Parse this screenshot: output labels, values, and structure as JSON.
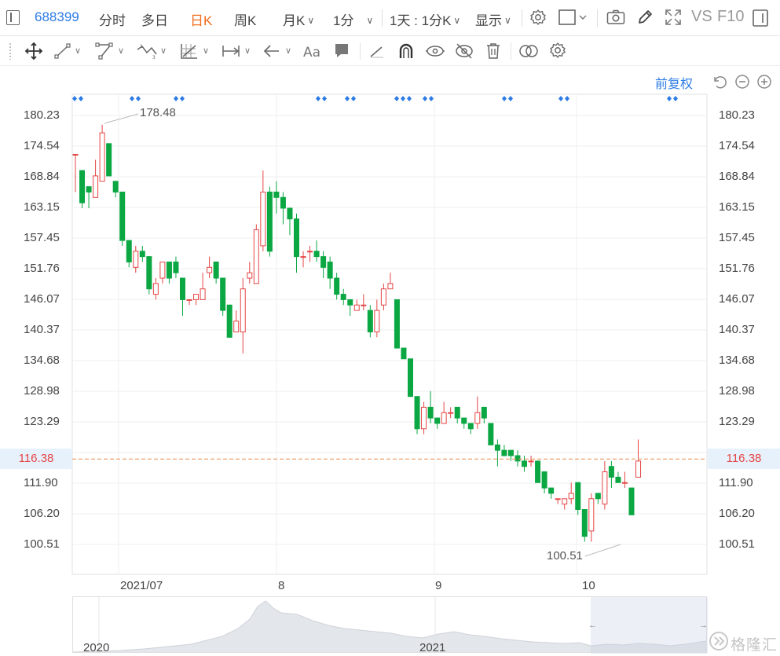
{
  "toolbar": {
    "stock_code": "688399",
    "intraday": "分时",
    "multi_day": "多日",
    "day_k": "日K",
    "week_k": "周K",
    "month_k": "月K",
    "minute_1": "1分",
    "interval": "1天 : 1分K",
    "display": "显示",
    "vs": "VS",
    "f10": "F10"
  },
  "chart_tools": {
    "restore_right": "前复权"
  },
  "price_axis": {
    "ticks": [
      "180.23",
      "174.54",
      "168.84",
      "163.15",
      "157.45",
      "151.76",
      "146.07",
      "140.37",
      "134.68",
      "128.98",
      "123.29",
      "111.90",
      "106.20",
      "100.51"
    ],
    "current_price": "116.38",
    "max_label": "178.48",
    "min_label": "100.51"
  },
  "time_axis": {
    "labels": [
      "2021/07",
      "8",
      "9",
      "10"
    ]
  },
  "navigator": {
    "labels": [
      "2020",
      "2021"
    ]
  },
  "watermark": {
    "text": "格隆汇"
  },
  "colors": {
    "up": "#e54545",
    "down": "#0aa743",
    "accent": "#2c7be5",
    "active_tab": "#f26a1b",
    "current_line": "#e98a4a"
  },
  "chart_data": {
    "type": "candlestick",
    "candles": [
      [
        173,
        173,
        166,
        173
      ],
      [
        170,
        164,
        163,
        170
      ],
      [
        167,
        166,
        163,
        167
      ],
      [
        165,
        169,
        165,
        172
      ],
      [
        168,
        177,
        168,
        178.5
      ],
      [
        175,
        169,
        169,
        175
      ],
      [
        168,
        166,
        165,
        168
      ],
      [
        166,
        157,
        156,
        166
      ],
      [
        157,
        153,
        152,
        157
      ],
      [
        152,
        155,
        151,
        156
      ],
      [
        155,
        154,
        153,
        156
      ],
      [
        154,
        148,
        147,
        154
      ],
      [
        147,
        149,
        146,
        150
      ],
      [
        150,
        153,
        149,
        153
      ],
      [
        153,
        150,
        149,
        153
      ],
      [
        153,
        151,
        150,
        154
      ],
      [
        150,
        146,
        143,
        150
      ],
      [
        146,
        146,
        145,
        146
      ],
      [
        146,
        147,
        145,
        147
      ],
      [
        146,
        148,
        147,
        151
      ],
      [
        151,
        152,
        150,
        154
      ],
      [
        153,
        150,
        149,
        153
      ],
      [
        150,
        144,
        143,
        150
      ],
      [
        145,
        139,
        139,
        145
      ],
      [
        140,
        142,
        140,
        144
      ],
      [
        140,
        148,
        136,
        150
      ],
      [
        150,
        151,
        149,
        153
      ],
      [
        149,
        159,
        149,
        160
      ],
      [
        156,
        166,
        155,
        170
      ],
      [
        166,
        155,
        154,
        167
      ],
      [
        166,
        165,
        162,
        168
      ],
      [
        165,
        163,
        160,
        166
      ],
      [
        163,
        161,
        158,
        163
      ],
      [
        161,
        154,
        151,
        162
      ],
      [
        154,
        154,
        152,
        155
      ],
      [
        155,
        155,
        153,
        156
      ],
      [
        155,
        154,
        153,
        157
      ],
      [
        154,
        152,
        150,
        155
      ],
      [
        153,
        150,
        148,
        154
      ],
      [
        150,
        147,
        146,
        151
      ],
      [
        147,
        146,
        145,
        148
      ],
      [
        146,
        145,
        143,
        146
      ],
      [
        144,
        145,
        144,
        146
      ],
      [
        145,
        145,
        144,
        147
      ],
      [
        144,
        140,
        139,
        145
      ],
      [
        140,
        144,
        139,
        146
      ],
      [
        145,
        148,
        144,
        149
      ],
      [
        148,
        149,
        148,
        151
      ],
      [
        146,
        137,
        137,
        146
      ],
      [
        137,
        135,
        135,
        137
      ],
      [
        135,
        128,
        128,
        135
      ],
      [
        128,
        122,
        121,
        128
      ],
      [
        122,
        126,
        121,
        127
      ],
      [
        126,
        124,
        123,
        129
      ],
      [
        124,
        123,
        122,
        124
      ],
      [
        123,
        125,
        123,
        127
      ],
      [
        125,
        125,
        124,
        126
      ],
      [
        126,
        124,
        123,
        126
      ],
      [
        124,
        123,
        122,
        124
      ],
      [
        123,
        122,
        121,
        123
      ],
      [
        123,
        125,
        122,
        128
      ],
      [
        126,
        124,
        123,
        126
      ],
      [
        123,
        119,
        119,
        123
      ],
      [
        119,
        118,
        115,
        120
      ],
      [
        118,
        117,
        117,
        119
      ],
      [
        118,
        117,
        116,
        118
      ],
      [
        117,
        116,
        115,
        118
      ],
      [
        116,
        115,
        114,
        117
      ],
      [
        116,
        116,
        115,
        117
      ],
      [
        116,
        112,
        112,
        116
      ],
      [
        114,
        111,
        110,
        114
      ],
      [
        111,
        110,
        109,
        111
      ],
      [
        109,
        109,
        108,
        109
      ],
      [
        108,
        109,
        107,
        109
      ],
      [
        109,
        110,
        108,
        112
      ],
      [
        112,
        107,
        106,
        112
      ],
      [
        107,
        102,
        101,
        107
      ],
      [
        103,
        109,
        101,
        110
      ],
      [
        110,
        109,
        108,
        110
      ],
      [
        108,
        114,
        107,
        116
      ],
      [
        115,
        113,
        111,
        116
      ],
      [
        113,
        112,
        112,
        114
      ],
      [
        112,
        112,
        111,
        114
      ],
      [
        111,
        106,
        106,
        111
      ],
      [
        113,
        116,
        113,
        120
      ]
    ],
    "ylim": [
      97,
      183
    ],
    "xlabels": [
      "2021/07",
      "8",
      "9",
      "10"
    ],
    "current_price": 116.38,
    "marked_high": 178.48,
    "marked_low": 100.51
  }
}
